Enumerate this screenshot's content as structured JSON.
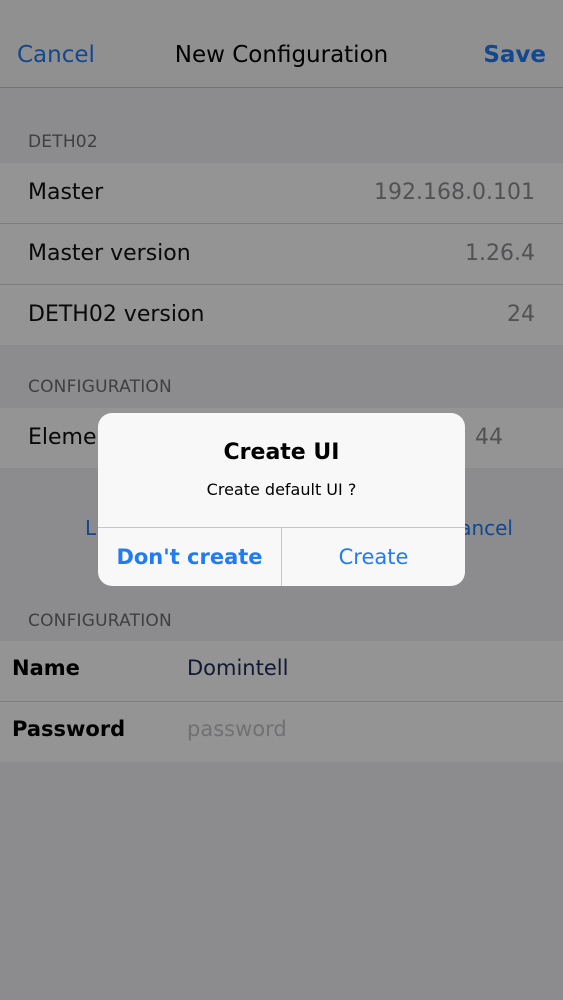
{
  "nav": {
    "cancel": "Cancel",
    "title": "New Configuration",
    "save": "Save"
  },
  "deth02": {
    "header": "DETH02",
    "rows": [
      {
        "label": "Master",
        "value": "192.168.0.101"
      },
      {
        "label": "Master version",
        "value": "1.26.4"
      },
      {
        "label": "DETH02 version",
        "value": "24"
      }
    ]
  },
  "configuration": {
    "header": "CONFIGURATION",
    "row": {
      "label": "Elemen",
      "value": "44"
    },
    "button_left": "L",
    "button_right": "ancel"
  },
  "credentials": {
    "header": "CONFIGURATION",
    "name_label": "Name",
    "name_value": "Domintell",
    "password_label": "Password",
    "password_placeholder": "password"
  },
  "alert": {
    "title": "Create UI",
    "message": "Create default UI ?",
    "dont_create": "Don't create",
    "create": "Create"
  },
  "colors": {
    "accent": "#1f7cf6",
    "background": "#f2f2f4",
    "dim_overlay": "rgba(0,0,0,0.42)"
  }
}
